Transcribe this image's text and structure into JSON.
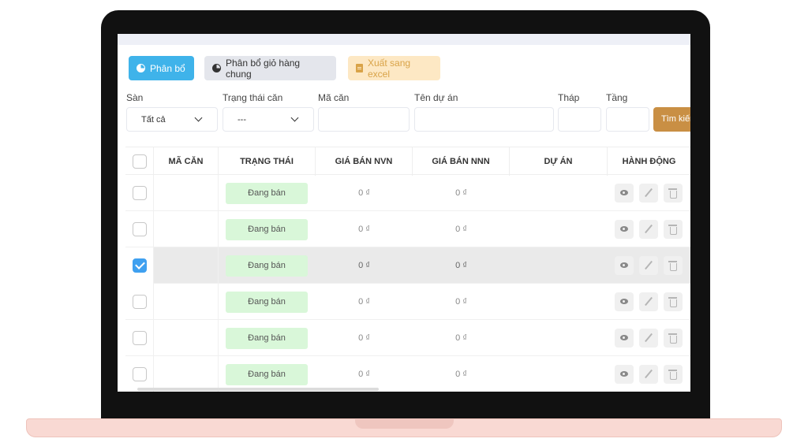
{
  "toolbar": {
    "allocate_label": "Phân bổ",
    "allocate_cart_label": "Phân bổ giỏ hàng chung",
    "export_excel_label": "Xuất sang excel"
  },
  "filters": {
    "floor_label": "Sàn",
    "floor_value": "Tất cả",
    "status_label": "Trạng thái căn",
    "status_value": "---",
    "unit_code_label": "Mã căn",
    "project_name_label": "Tên dự án",
    "tower_label": "Tháp",
    "level_label": "Tầng",
    "search_label": "Tìm kiếm"
  },
  "table": {
    "headers": [
      "MÃ CĂN",
      "TRẠNG THÁI",
      "GIÁ BÁN NVN",
      "GIÁ BÁN NNN",
      "DỰ ÁN",
      "HÀNH ĐỘNG"
    ],
    "rows": [
      {
        "unit_code": "",
        "status": "Đang bán",
        "price_nvn": "0 ₫",
        "price_nnn": "0 ₫",
        "project": "",
        "checked": false
      },
      {
        "unit_code": "",
        "status": "Đang bán",
        "price_nvn": "0 ₫",
        "price_nnn": "0 ₫",
        "project": "",
        "checked": false
      },
      {
        "unit_code": "",
        "status": "Đang bán",
        "price_nvn": "0 ₫",
        "price_nnn": "0 ₫",
        "project": "",
        "checked": true
      },
      {
        "unit_code": "",
        "status": "Đang bán",
        "price_nvn": "0 ₫",
        "price_nnn": "0 ₫",
        "project": "",
        "checked": false
      },
      {
        "unit_code": "",
        "status": "Đang bán",
        "price_nvn": "0 ₫",
        "price_nnn": "0 ₫",
        "project": "",
        "checked": false
      },
      {
        "unit_code": "",
        "status": "Đang bán",
        "price_nvn": "0 ₫",
        "price_nnn": "0 ₫",
        "project": "",
        "checked": false
      }
    ]
  },
  "colors": {
    "primary": "#3fb3ea",
    "excel": "#fde8c4",
    "search": "#c98f44",
    "status_badge": "#d9f7d9",
    "checkbox_checked": "#3fa0f0"
  }
}
